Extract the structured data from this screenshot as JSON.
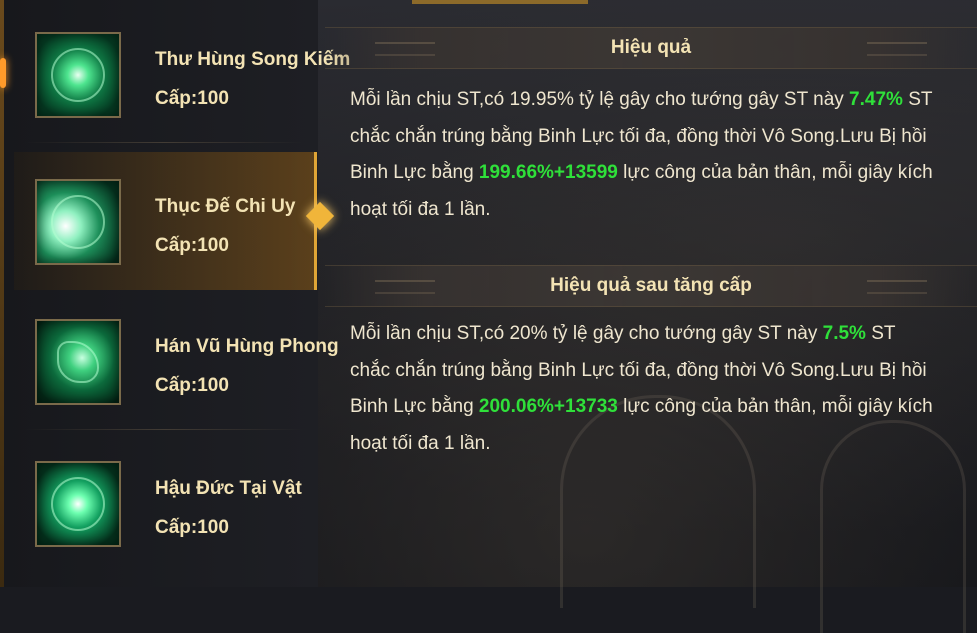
{
  "skills": [
    {
      "name": "Thư Hùng Song Kiếm",
      "level": "Cấp:100",
      "active": false
    },
    {
      "name": "Thục Đế Chi Uy",
      "level": "Cấp:100",
      "active": true
    },
    {
      "name": "Hán Vũ Hùng Phong",
      "level": "Cấp:100",
      "active": false
    },
    {
      "name": "Hậu Đức Tại Vật",
      "level": "Cấp:100",
      "active": false
    }
  ],
  "effect": {
    "title": "Hiệu quả",
    "p1": "Mỗi lần chịu ST,có  19.95% tỷ lệ gây cho tướng gây ST này ",
    "v1": "7.47%",
    "p2": " ST chắc chắn trúng bằng Binh Lực tối đa, đồng thời Vô Song.Lưu Bị hồi Binh Lực bằng ",
    "v2": "199.66%+13599",
    "p3": " lực công của bản thân, mỗi giây kích hoạt tối đa 1 lần."
  },
  "upgrade": {
    "title": "Hiệu quả sau tăng cấp",
    "p1": "Mỗi lần chịu ST,có  20% tỷ lệ gây cho tướng gây ST này ",
    "v1": "7.5%",
    "p2": " ST chắc chắn trúng bằng Binh Lực tối đa, đồng thời Vô Song.Lưu Bị hồi Binh Lực bằng ",
    "v2": "200.06%+13733",
    "p3": " lực công của bản thân, mỗi giây kích hoạt tối đa 1 lần."
  },
  "colors": {
    "highlight": "#2fe03a",
    "gold_text": "#f3e3b4",
    "accent": "#f0b53a"
  }
}
